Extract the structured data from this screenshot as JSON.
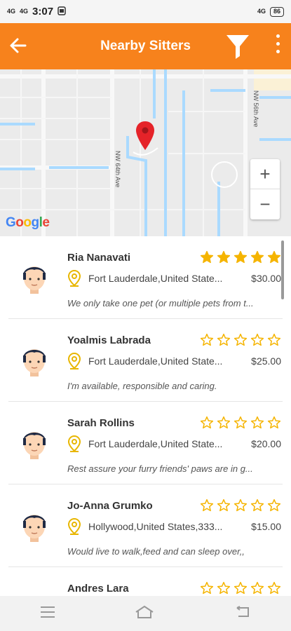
{
  "status": {
    "signal1": "4G",
    "signal2": "4G",
    "time": "3:07",
    "signal_right": "4G",
    "battery": "86"
  },
  "appbar": {
    "title": "Nearby Sitters"
  },
  "map": {
    "street_1": "NW 64th Ave",
    "street_2": "NW 56th Ave",
    "zoom_in": "+",
    "zoom_out": "−",
    "attribution": "Google"
  },
  "sitters": [
    {
      "name": "Ria Nanavati",
      "location": "Fort Lauderdale,United State...",
      "price": "$30.00",
      "description": "We only take one pet (or multiple pets from t...",
      "rating": 5
    },
    {
      "name": "Yoalmis Labrada",
      "location": "Fort Lauderdale,United State...",
      "price": "$25.00",
      "description": "I'm available, responsible and caring.",
      "rating": 0
    },
    {
      "name": "Sarah Rollins",
      "location": "Fort Lauderdale,United State...",
      "price": "$20.00",
      "description": "Rest assure your furry friends' paws are in g...",
      "rating": 0
    },
    {
      "name": "Jo-Anna Grumko",
      "location": "Hollywood,United States,333...",
      "price": "$15.00",
      "description": "Would live to walk,feed and can sleep over,,",
      "rating": 0
    },
    {
      "name": "Andres Lara",
      "location": "",
      "price": "",
      "description": "",
      "rating": 0
    }
  ],
  "colors": {
    "accent": "#f7821c",
    "star": "#f5b400",
    "pin": "#e8b600"
  }
}
